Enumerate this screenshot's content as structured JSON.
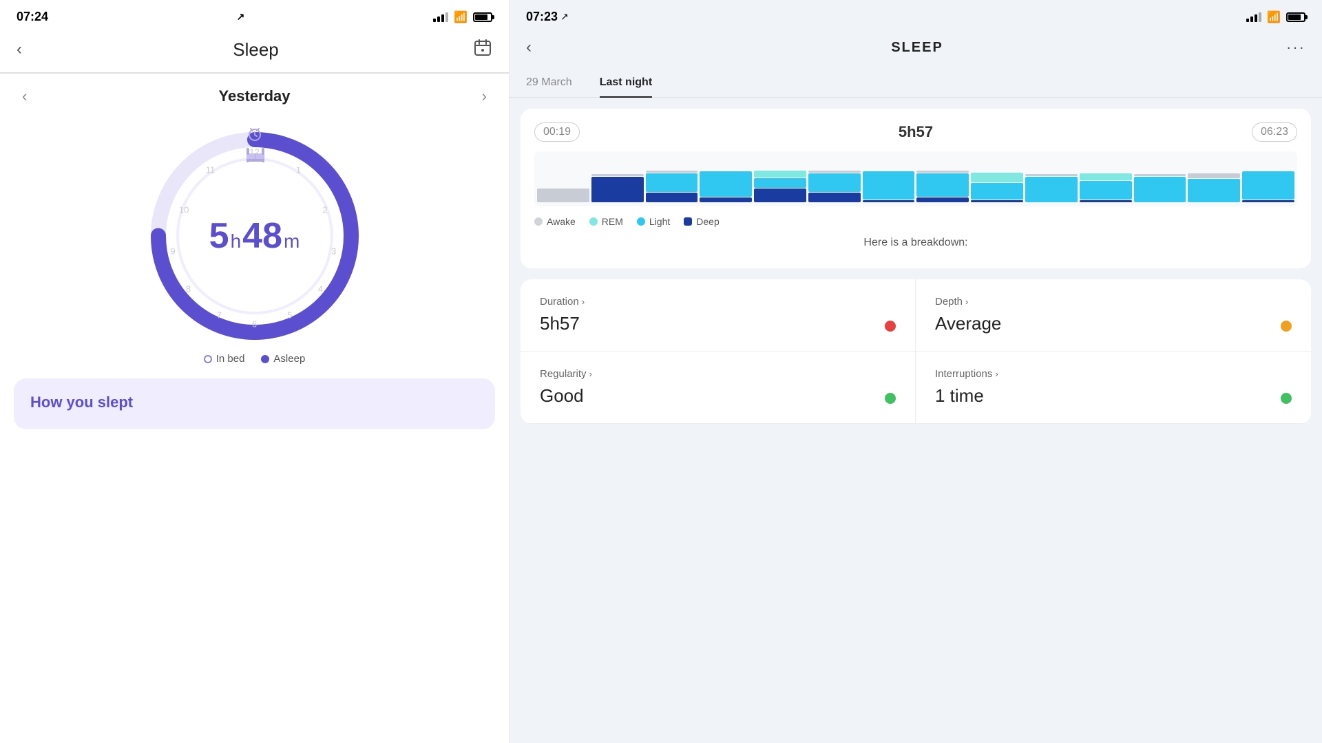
{
  "left": {
    "status_bar": {
      "time": "07:24",
      "location_icon": "↗"
    },
    "nav": {
      "back_label": "‹",
      "title": "Sleep",
      "calendar_icon": "📅"
    },
    "date_nav": {
      "prev_label": "‹",
      "date": "Yesterday",
      "next_label": "›"
    },
    "clock": {
      "hours": "5",
      "h_label": "h",
      "minutes": "48",
      "m_label": "m"
    },
    "legend": {
      "in_bed_label": "In bed",
      "asleep_label": "Asleep"
    },
    "how_slept": {
      "title": "How you slept"
    }
  },
  "right": {
    "status_bar": {
      "time": "07:23",
      "location_icon": "↗"
    },
    "nav": {
      "back_label": "‹",
      "title": "SLEEP",
      "menu_label": "···"
    },
    "tabs": [
      {
        "label": "29 March",
        "active": false
      },
      {
        "label": "Last night",
        "active": true
      }
    ],
    "chart": {
      "start_time": "00:19",
      "duration": "5h57",
      "end_time": "06:23",
      "legend": [
        {
          "label": "Awake",
          "color": "#d0d4da"
        },
        {
          "label": "REM",
          "color": "#80e8e0"
        },
        {
          "label": "Light",
          "color": "#30c8f0"
        },
        {
          "label": "Deep",
          "color": "#1a3ca0"
        }
      ],
      "bars": [
        {
          "awake": 30,
          "rem": 0,
          "light": 0,
          "deep": 0,
          "gray": true
        },
        {
          "awake": 5,
          "rem": 0,
          "light": 0,
          "deep": 55,
          "gray": false
        },
        {
          "awake": 5,
          "rem": 0,
          "light": 40,
          "deep": 20,
          "gray": false
        },
        {
          "awake": 0,
          "rem": 0,
          "light": 55,
          "deep": 10,
          "gray": false
        },
        {
          "awake": 0,
          "rem": 15,
          "light": 20,
          "deep": 30,
          "gray": false
        },
        {
          "awake": 5,
          "rem": 0,
          "light": 40,
          "deep": 20,
          "gray": false
        },
        {
          "awake": 0,
          "rem": 0,
          "light": 60,
          "deep": 5,
          "gray": false
        },
        {
          "awake": 5,
          "rem": 0,
          "light": 50,
          "deep": 10,
          "gray": false
        },
        {
          "awake": 0,
          "rem": 20,
          "light": 35,
          "deep": 5,
          "gray": false
        },
        {
          "awake": 5,
          "rem": 0,
          "light": 55,
          "deep": 0,
          "gray": false
        },
        {
          "awake": 0,
          "rem": 15,
          "light": 40,
          "deep": 5,
          "gray": false
        },
        {
          "awake": 5,
          "rem": 0,
          "light": 55,
          "deep": 0,
          "gray": false
        },
        {
          "awake": 10,
          "rem": 0,
          "light": 50,
          "deep": 0,
          "gray": false
        },
        {
          "awake": 0,
          "rem": 0,
          "light": 60,
          "deep": 5,
          "gray": false
        }
      ]
    },
    "breakdown_text": "Here is a breakdown:",
    "stats": [
      {
        "label": "Duration",
        "value": "5h57",
        "dot_color": "dot-red",
        "has_arrow": true
      },
      {
        "label": "Depth",
        "value": "Average",
        "dot_color": "dot-orange",
        "has_arrow": true
      },
      {
        "label": "Regularity",
        "value": "Good",
        "dot_color": "dot-green",
        "has_arrow": true
      },
      {
        "label": "Interruptions",
        "value": "1 time",
        "dot_color": "dot-green",
        "has_arrow": true
      }
    ]
  }
}
